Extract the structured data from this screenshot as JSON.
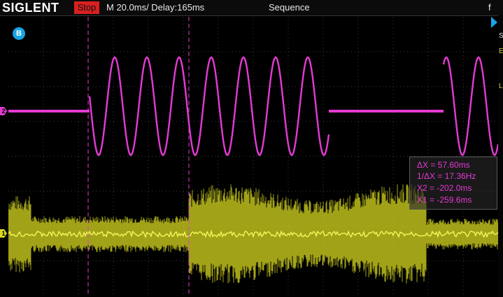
{
  "header": {
    "brand": "SIGLENT",
    "run_status": "Stop",
    "timebase": "M 20.0ms/ Delay:165ms",
    "acquisition_mode": "Sequence",
    "menu_glyph": "f"
  },
  "channels": {
    "ch1": {
      "label": "1",
      "color": "#d8d820"
    },
    "ch2": {
      "label": "2",
      "color": "#e43ad2"
    }
  },
  "badge": {
    "label": "B",
    "color": "#18a4e6"
  },
  "cursors": {
    "delta_x": "ΔX = 57.60ms",
    "inv_delta_x": "1/ΔX = 17.36Hz",
    "x2": "X2 = -202.0ms",
    "x1": "X1 = -259.6ms",
    "color": "#e43ad2"
  },
  "colors": {
    "background": "#000000",
    "grid": "#3a3a3a",
    "stop": "#d92020"
  }
}
